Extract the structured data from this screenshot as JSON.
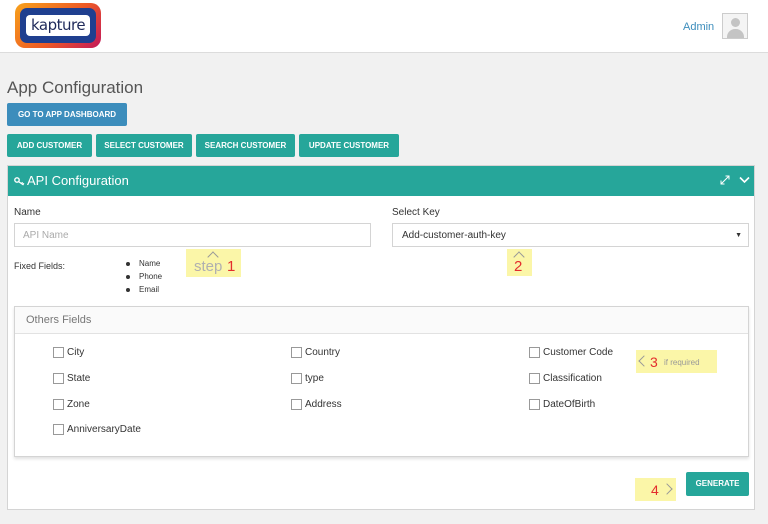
{
  "header": {
    "logo_text": "kapture",
    "user_label": "Admin"
  },
  "page": {
    "title": "App Configuration",
    "dashboard_button": "GO TO APP DASHBOARD",
    "action_buttons": [
      "ADD CUSTOMER",
      "SELECT CUSTOMER",
      "SEARCH CUSTOMER",
      "UPDATE CUSTOMER"
    ]
  },
  "panel": {
    "title": "API Configuration",
    "name_label": "Name",
    "name_placeholder": "API Name",
    "select_key_label": "Select Key",
    "select_key_value": "Add-customer-auth-key",
    "fixed_fields_label": "Fixed Fields:",
    "fixed_fields": [
      "Name",
      "Phone",
      "Email"
    ],
    "others_title": "Others Fields",
    "others_fields": [
      "City",
      "Country",
      "Customer Code",
      "State",
      "type",
      "Classification",
      "Zone",
      "Address",
      "DateOfBirth",
      "AnniversaryDate"
    ],
    "generate_button": "GENERATE"
  },
  "annotations": {
    "step1_word": "step",
    "step1_number": "1",
    "step2_number": "2",
    "step3_number": "3",
    "step3_note": "if required",
    "step4_number": "4"
  },
  "colors": {
    "teal": "#26a69a",
    "blue": "#3c8dbc",
    "note_background": "#fbf6a8",
    "note_number": "#e32d2d"
  },
  "icons": {
    "panel_title": "key-icon",
    "expand": "expand-icon",
    "collapse": "chevron-down-icon",
    "select": "caret-down-icon",
    "user": "user-avatar-icon"
  }
}
